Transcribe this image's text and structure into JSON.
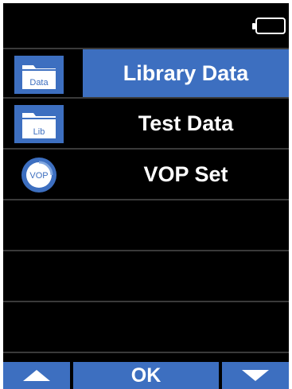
{
  "menu": {
    "items": [
      {
        "label": "Library Data",
        "icon": "folder-data-icon",
        "icon_text": "Data",
        "selected": true
      },
      {
        "label": "Test Data",
        "icon": "folder-lib-icon",
        "icon_text": "Lib",
        "selected": false
      },
      {
        "label": "VOP Set",
        "icon": "vop-icon",
        "icon_text": "VOP",
        "selected": false
      }
    ]
  },
  "navbar": {
    "ok_label": "OK",
    "up_icon": "arrow-up-icon",
    "down_icon": "arrow-down-icon"
  },
  "status": {
    "battery_icon": "battery-icon"
  },
  "colors": {
    "accent": "#3d6fc0",
    "background": "#000000",
    "text": "#ffffff"
  }
}
